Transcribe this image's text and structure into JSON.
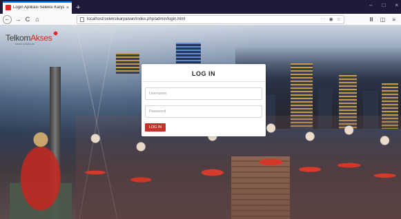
{
  "browser": {
    "tab_title": "Login Aplikasi Seleksi Karyawa…",
    "tab_close": "×",
    "new_tab": "+",
    "win_minimize": "–",
    "win_maximize": "□",
    "win_close": "×",
    "back": "←",
    "forward": "→",
    "reload": "C",
    "home": "⌂",
    "url": "localhost/seleksikaryawan/index.php/admin/login.html",
    "url_more": "···",
    "url_pocket": "◉",
    "url_bookmark": "☆",
    "toolbar_library": "Ⅲ",
    "toolbar_sidebar": "◫",
    "toolbar_menu": "≡"
  },
  "logo": {
    "name_part1": "Telkom",
    "name_part2": "Akses",
    "tagline": "smart solutions"
  },
  "login": {
    "title": "LOG IN",
    "username_placeholder": "Username",
    "password_placeholder": "Password",
    "button_label": "LOG IN"
  },
  "colors": {
    "accent": "#c9302c",
    "brand_red": "#e2231a",
    "tabbar": "#1e1b3a"
  }
}
